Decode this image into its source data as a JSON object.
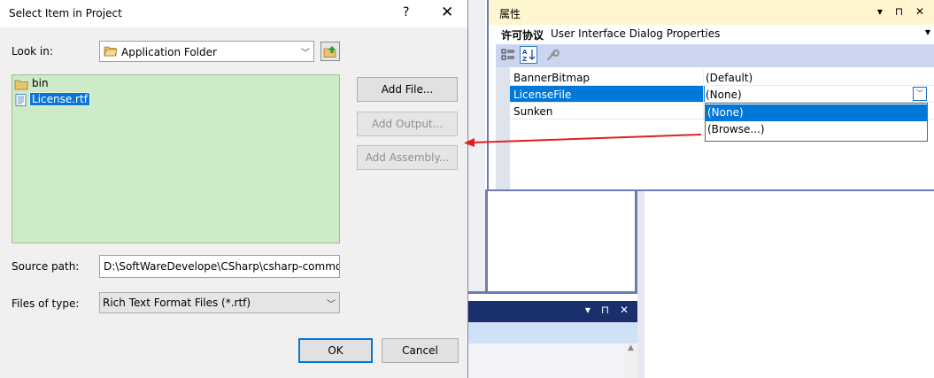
{
  "dialog": {
    "title": "Select Item in Project",
    "help_glyph": "?",
    "close_glyph": "✕",
    "look_in_label": "Look in:",
    "look_in_value": "Application Folder",
    "files": [
      {
        "name": "bin",
        "type": "folder",
        "selected": false
      },
      {
        "name": "License.rtf",
        "type": "file",
        "selected": true
      }
    ],
    "buttons": {
      "add_file": "Add File...",
      "add_output": "Add Output...",
      "add_assembly": "Add Assembly..."
    },
    "source_path_label": "Source path:",
    "source_path_value": "D:\\SoftWareDevelope\\CSharp\\csharp-commo",
    "files_of_type_label": "Files of type:",
    "files_of_type_value": "Rich Text Format Files (*.rtf)",
    "ok": "OK",
    "cancel": "Cancel"
  },
  "properties": {
    "title": "属性",
    "title_buttons": "▾ ⊓ ✕",
    "object_strong": "许可协议",
    "object_name": "User Interface Dialog Properties",
    "rows": [
      {
        "name": "BannerBitmap",
        "value": "(Default)"
      },
      {
        "name": "LicenseFile",
        "value": "(None)"
      },
      {
        "name": "Sunken",
        "value": ""
      }
    ],
    "dropdown_options": [
      "(None)",
      "(Browse...)"
    ],
    "dropdown_selected": "(None)"
  },
  "ide": {
    "sub_window_buttons": "▾ ⊓ ✕"
  },
  "colors": {
    "accent": "#0078d7",
    "file_list_bg": "#ccebc6",
    "props_title_bg": "#fff6cf",
    "annotation_arrow": "#e02020"
  }
}
